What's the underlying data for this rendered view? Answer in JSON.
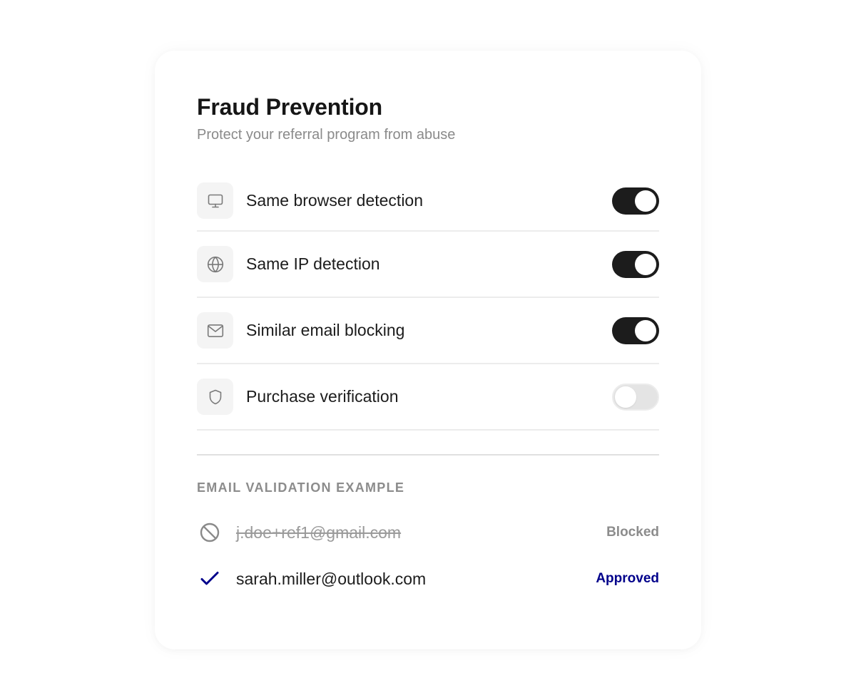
{
  "header": {
    "title": "Fraud Prevention",
    "subtitle": "Protect your referral program from abuse"
  },
  "settings": [
    {
      "label": "Same browser detection",
      "icon": "monitor-icon",
      "enabled": true
    },
    {
      "label": "Same IP detection",
      "icon": "globe-icon",
      "enabled": true
    },
    {
      "label": "Similar email blocking",
      "icon": "mail-icon",
      "enabled": true
    },
    {
      "label": "Purchase verification",
      "icon": "shield-icon",
      "enabled": false
    }
  ],
  "validation": {
    "section_label": "EMAIL VALIDATION EXAMPLE",
    "items": [
      {
        "email": "j.doe+ref1@gmail.com",
        "status": "Blocked",
        "icon": "blocked-icon"
      },
      {
        "email": "sarah.miller@outlook.com",
        "status": "Approved",
        "icon": "check-icon"
      }
    ]
  },
  "colors": {
    "toggle_on": "#1c1c1c",
    "toggle_off": "#e4e4e4",
    "approved": "#00008b",
    "blocked": "#8c8c8c"
  }
}
